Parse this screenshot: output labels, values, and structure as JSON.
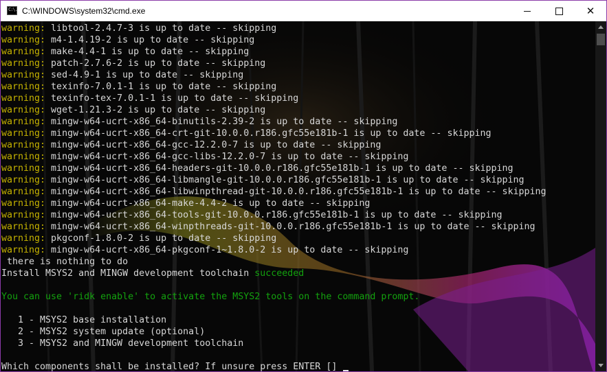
{
  "window": {
    "title": "C:\\WINDOWS\\system32\\cmd.exe",
    "icon_text": "C:\\.",
    "icons": {
      "app": "cmd-icon",
      "minimize": "minimize-icon",
      "maximize": "maximize-icon",
      "close": "close-icon"
    },
    "close_glyph": "✕"
  },
  "colors": {
    "warning": "#c6b300",
    "success": "#13a10e",
    "text": "#d7d7d7",
    "accent_border": "#8a3aa8"
  },
  "console": {
    "lines": [
      {
        "prefix": "warning:",
        "text": " libtool-2.4.7-3 is up to date -- skipping"
      },
      {
        "prefix": "warning:",
        "text": " m4-1.4.19-2 is up to date -- skipping"
      },
      {
        "prefix": "warning:",
        "text": " make-4.4-1 is up to date -- skipping"
      },
      {
        "prefix": "warning:",
        "text": " patch-2.7.6-2 is up to date -- skipping"
      },
      {
        "prefix": "warning:",
        "text": " sed-4.9-1 is up to date -- skipping"
      },
      {
        "prefix": "warning:",
        "text": " texinfo-7.0.1-1 is up to date -- skipping"
      },
      {
        "prefix": "warning:",
        "text": " texinfo-tex-7.0.1-1 is up to date -- skipping"
      },
      {
        "prefix": "warning:",
        "text": " wget-1.21.3-2 is up to date -- skipping"
      },
      {
        "prefix": "warning:",
        "text": " mingw-w64-ucrt-x86_64-binutils-2.39-2 is up to date -- skipping"
      },
      {
        "prefix": "warning:",
        "text": " mingw-w64-ucrt-x86_64-crt-git-10.0.0.r186.gfc55e181b-1 is up to date -- skipping"
      },
      {
        "prefix": "warning:",
        "text": " mingw-w64-ucrt-x86_64-gcc-12.2.0-7 is up to date -- skipping"
      },
      {
        "prefix": "warning:",
        "text": " mingw-w64-ucrt-x86_64-gcc-libs-12.2.0-7 is up to date -- skipping"
      },
      {
        "prefix": "warning:",
        "text": " mingw-w64-ucrt-x86_64-headers-git-10.0.0.r186.gfc55e181b-1 is up to date -- skipping"
      },
      {
        "prefix": "warning:",
        "text": " mingw-w64-ucrt-x86_64-libmangle-git-10.0.0.r186.gfc55e181b-1 is up to date -- skipping"
      },
      {
        "prefix": "warning:",
        "text": " mingw-w64-ucrt-x86_64-libwinpthread-git-10.0.0.r186.gfc55e181b-1 is up to date -- skipping"
      },
      {
        "prefix": "warning:",
        "text": " mingw-w64-ucrt-x86_64-make-4.4-2 is up to date -- skipping"
      },
      {
        "prefix": "warning:",
        "text": " mingw-w64-ucrt-x86_64-tools-git-10.0.0.r186.gfc55e181b-1 is up to date -- skipping"
      },
      {
        "prefix": "warning:",
        "text": " mingw-w64-ucrt-x86_64-winpthreads-git-10.0.0.r186.gfc55e181b-1 is up to date -- skipping"
      },
      {
        "prefix": "warning:",
        "text": " pkgconf-1.8.0-2 is up to date -- skipping"
      },
      {
        "prefix": "warning:",
        "text": " mingw-w64-ucrt-x86_64-pkgconf-1~1.8.0-2 is up to date -- skipping"
      },
      {
        "text": " there is nothing to do"
      },
      {
        "text": "Install MSYS2 and MINGW development toolchain ",
        "suffix": "succeeded",
        "suffix_color": "green"
      },
      {
        "text": ""
      },
      {
        "text": "You can use 'ridk enable' to activate the MSYS2 tools on the command prompt.",
        "color": "green"
      },
      {
        "text": ""
      },
      {
        "text": "   1 - MSYS2 base installation"
      },
      {
        "text": "   2 - MSYS2 system update (optional)"
      },
      {
        "text": "   3 - MSYS2 and MINGW development toolchain"
      },
      {
        "text": ""
      },
      {
        "text": "Which components shall be installed? If unsure press ENTER [] ",
        "cursor": true
      }
    ]
  }
}
